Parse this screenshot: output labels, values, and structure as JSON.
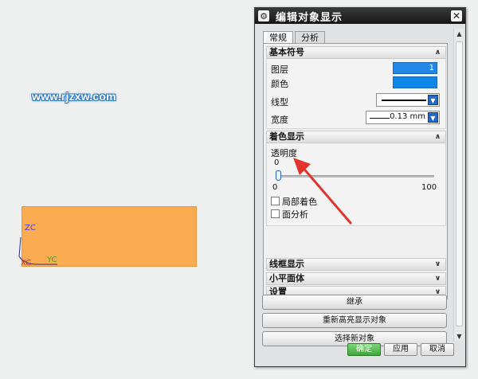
{
  "canvas": {
    "watermark": "www.rjzxw.com",
    "axes": {
      "z": "ZC",
      "y": "YC",
      "x": "XC"
    },
    "colors": {
      "part": "#fbac53",
      "background": "#eef0f0"
    }
  },
  "dialog": {
    "title": "编辑对象显示",
    "close_glyph": "✕",
    "tabs": [
      {
        "label": "常规",
        "active": true
      },
      {
        "label": "分析",
        "active": false
      }
    ],
    "basic_symbols": {
      "header": "基本符号",
      "layer_label": "图层",
      "layer_value": "1",
      "color_label": "颜色",
      "color_value": "#0d88e8",
      "linetype_label": "线型",
      "width_label": "宽度",
      "width_value": "0.13 mm"
    },
    "shading": {
      "header": "着色显示",
      "transparency_label": "透明度",
      "transparency_value": "0",
      "slider_min": "0",
      "slider_max": "100",
      "transparency_level": 0,
      "local_shading_label": "局部着色",
      "face_analysis_label": "面分析"
    },
    "collapsed_sections": [
      {
        "label": "线框显示"
      },
      {
        "label": "小平面体"
      },
      {
        "label": "设置"
      }
    ],
    "buttons": {
      "inherit": "继承",
      "rehighlight": "重新高亮显示对象",
      "select_new": "选择新对象",
      "ok": "确定",
      "apply": "应用",
      "cancel": "取消"
    },
    "colors": {
      "titlebar": "#1e1e1e",
      "ok_button": "#4cb046",
      "annotation_arrow": "#e2342d"
    }
  }
}
